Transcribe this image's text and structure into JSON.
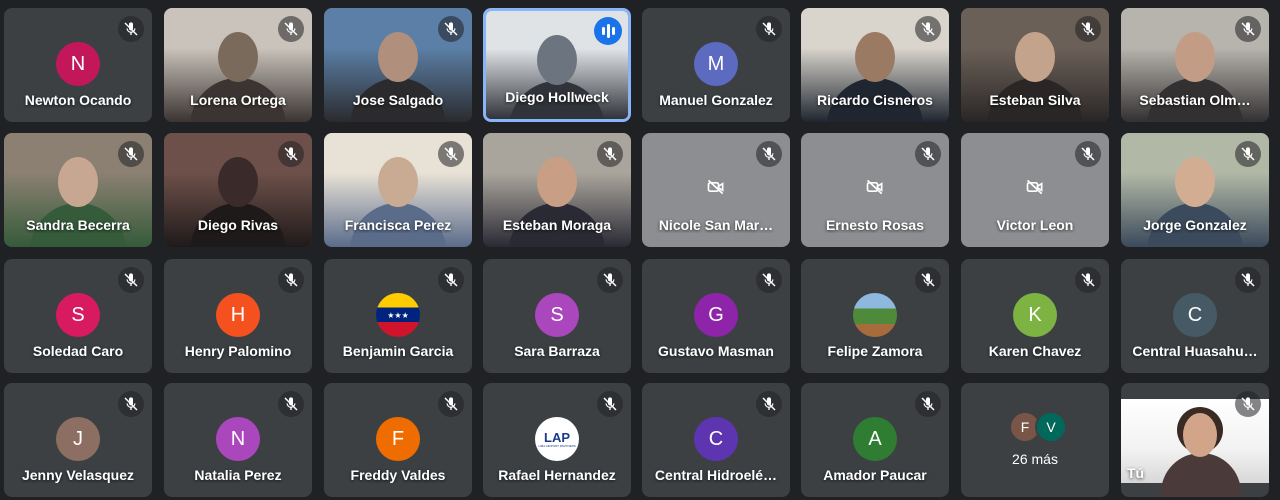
{
  "participants": [
    {
      "id": "newton",
      "name": "Newton Ocando",
      "avatar_letter": "N",
      "avatar_color": "#c2185b"
    },
    {
      "id": "lorena",
      "name": "Lorena Ortega",
      "video": true
    },
    {
      "id": "jose",
      "name": "Jose Salgado",
      "video": true
    },
    {
      "id": "diego-h",
      "name": "Diego Hollweck",
      "video": true,
      "speaking": true
    },
    {
      "id": "manuel",
      "name": "Manuel Gonzalez",
      "avatar_letter": "M",
      "avatar_color": "#5c6bc0"
    },
    {
      "id": "ricardo",
      "name": "Ricardo Cisneros",
      "video": true
    },
    {
      "id": "esteban-s",
      "name": "Esteban Silva",
      "video": true
    },
    {
      "id": "sebastian",
      "name": "Sebastian Olm…",
      "video": true
    },
    {
      "id": "sandra",
      "name": "Sandra Becerra",
      "video": true
    },
    {
      "id": "diego-r",
      "name": "Diego Rivas",
      "video": true
    },
    {
      "id": "francisca",
      "name": "Francisca Perez",
      "video": true
    },
    {
      "id": "esteban-m",
      "name": "Esteban Moraga",
      "video": true
    },
    {
      "id": "nicole",
      "name": "Nicole San Mar…",
      "camera_off": true
    },
    {
      "id": "ernesto",
      "name": "Ernesto Rosas",
      "camera_off": true
    },
    {
      "id": "victor",
      "name": "Victor Leon",
      "camera_off": true
    },
    {
      "id": "jorge",
      "name": "Jorge Gonzalez",
      "video": true
    },
    {
      "id": "soledad",
      "name": "Soledad Caro",
      "avatar_letter": "S",
      "avatar_color": "#d81b60"
    },
    {
      "id": "henry",
      "name": "Henry Palomino",
      "avatar_letter": "H",
      "avatar_color": "#f4511e"
    },
    {
      "id": "benjamin",
      "name": "Benjamin Garcia",
      "avatar_image": "venezuela-flag"
    },
    {
      "id": "sara",
      "name": "Sara Barraza",
      "avatar_letter": "S",
      "avatar_color": "#ab47bc"
    },
    {
      "id": "gustavo",
      "name": "Gustavo Masman",
      "avatar_letter": "G",
      "avatar_color": "#8e24aa"
    },
    {
      "id": "felipe",
      "name": "Felipe Zamora",
      "avatar_image": "landscape-photo"
    },
    {
      "id": "karen",
      "name": "Karen Chavez",
      "avatar_letter": "K",
      "avatar_color": "#7cb342"
    },
    {
      "id": "central-h",
      "name": "Central Huasahu…",
      "avatar_letter": "C",
      "avatar_color": "#455a64"
    },
    {
      "id": "jenny",
      "name": "Jenny Velasquez",
      "avatar_letter": "J",
      "avatar_color": "#8d6e63"
    },
    {
      "id": "natalia",
      "name": "Natalia Perez",
      "avatar_letter": "N",
      "avatar_color": "#ab47bc"
    },
    {
      "id": "freddy",
      "name": "Freddy Valdes",
      "avatar_letter": "F",
      "avatar_color": "#ef6c00"
    },
    {
      "id": "rafael",
      "name": "Rafael Hernandez",
      "avatar_image": "lap-logo",
      "logo_text": "LAP",
      "logo_subtext": "LIMA AIRPORT PARTNERS"
    },
    {
      "id": "central-hidro",
      "name": "Central Hidroelé…",
      "avatar_letter": "C",
      "avatar_color": "#5e35b1"
    },
    {
      "id": "amador",
      "name": "Amador Paucar",
      "avatar_letter": "A",
      "avatar_color": "#2e7d32"
    }
  ],
  "more_tile": {
    "avatars": [
      {
        "letter": "F",
        "color": "#795548"
      },
      {
        "letter": "V",
        "color": "#00695c"
      }
    ],
    "label": "26 más"
  },
  "self_tile": {
    "label": "Tú"
  },
  "colors": {
    "background": "#202124",
    "tile": "#3c4043",
    "camera_off_tile": "#8d8e91",
    "speaking_border": "#8ab4f8",
    "speaking_badge": "#1a73e8"
  },
  "icons": {
    "mute": "mic-off-icon",
    "speaking": "audio-level-icon",
    "camera_off": "videocam-off-icon"
  }
}
